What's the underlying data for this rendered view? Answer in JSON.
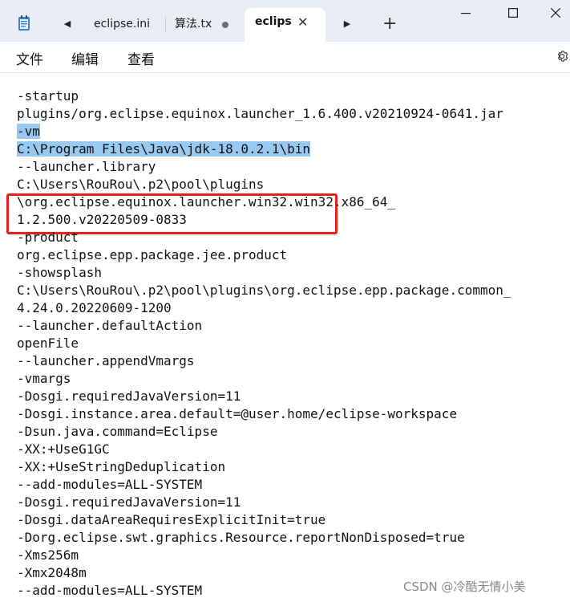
{
  "tabs": [
    {
      "label": "eclipse.ini",
      "active": false
    },
    {
      "label": "算法.tx",
      "active": false,
      "modified": true
    },
    {
      "label": "eclips",
      "active": true
    }
  ],
  "menu": [
    "文件",
    "编辑",
    "查看"
  ],
  "editor": {
    "lines": [
      "-startup",
      "plugins/org.eclipse.equinox.launcher_1.6.400.v20210924-0641.jar",
      "-vm",
      "C:\\Program Files\\Java\\jdk-18.0.2.1\\bin",
      "--launcher.library",
      "C:\\Users\\RouRou\\.p2\\pool\\plugins",
      "\\org.eclipse.equinox.launcher.win32.win32.x86_64_",
      "1.2.500.v20220509-0833",
      "-product",
      "org.eclipse.epp.package.jee.product",
      "-showsplash",
      "C:\\Users\\RouRou\\.p2\\pool\\plugins\\org.eclipse.epp.package.common_",
      "4.24.0.20220609-1200",
      "--launcher.defaultAction",
      "openFile",
      "--launcher.appendVmargs",
      "-vmargs",
      "-Dosgi.requiredJavaVersion=11",
      "-Dosgi.instance.area.default=@user.home/eclipse-workspace",
      "-Dsun.java.command=Eclipse",
      "-XX:+UseG1GC",
      "-XX:+UseStringDeduplication",
      "--add-modules=ALL-SYSTEM",
      "-Dosgi.requiredJavaVersion=11",
      "-Dosgi.dataAreaRequiresExplicitInit=true",
      "-Dorg.eclipse.swt.graphics.Resource.reportNonDisposed=true",
      "-Xms256m",
      "-Xmx2048m",
      "--add-modules=ALL-SYSTEM"
    ],
    "selected_lines": [
      2,
      3
    ]
  },
  "icons": {
    "app": "notepad-icon",
    "settings": "gear-icon",
    "close": "close-icon",
    "add": "add-icon"
  },
  "colors": {
    "selection": "#99c9f0",
    "highlight_box": "#e8201c",
    "tabbar_bg": "#e9eef4"
  },
  "watermark": "CSDN @冷酷无情小美"
}
